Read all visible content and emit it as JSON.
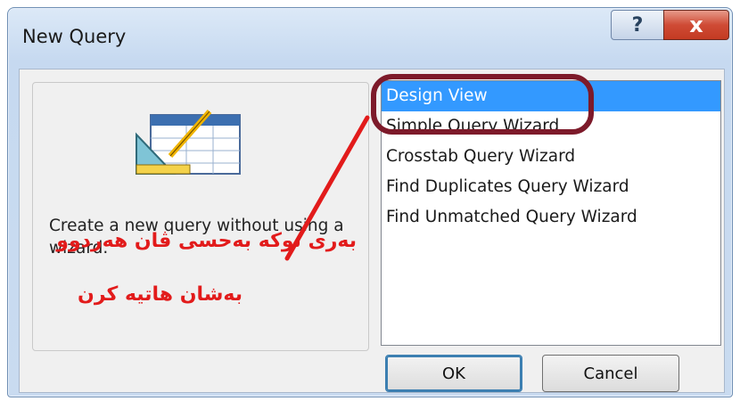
{
  "window": {
    "title": "New Query",
    "help_label": "?",
    "close_label": "x"
  },
  "description": "Create a new query without using a wizard.",
  "list": {
    "items": [
      {
        "label": "Design View",
        "selected": true
      },
      {
        "label": "Simple Query Wizard",
        "selected": false
      },
      {
        "label": "Crosstab Query Wizard",
        "selected": false
      },
      {
        "label": "Find Duplicates Query Wizard",
        "selected": false
      },
      {
        "label": "Find Unmatched Query Wizard",
        "selected": false
      }
    ]
  },
  "buttons": {
    "ok_label": "OK",
    "cancel_label": "Cancel"
  },
  "annotation": {
    "line1": "بەری نوکە بەحسی ڤان هەردوو",
    "line2": "بەشان هاتیە کرن",
    "color": "#e21b1b",
    "oval_color": "#7d1a2a"
  },
  "icons": {
    "wizard": "query-design-icon"
  },
  "colors": {
    "selection": "#3399ff",
    "close_button": "#c33a22"
  }
}
